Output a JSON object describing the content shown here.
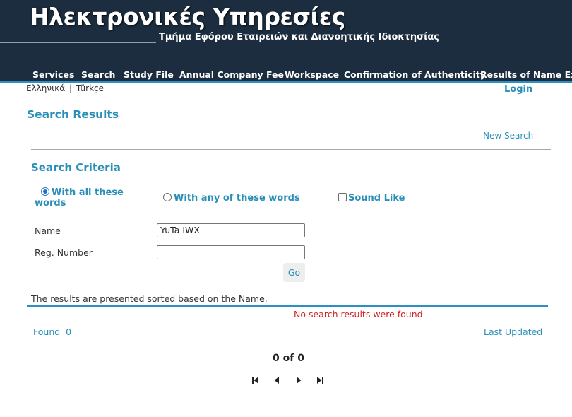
{
  "header": {
    "title": "Ηλεκτρονικές Υπηρεσίες",
    "subtitle": "Τμήμα Εφόρου Εταιρειών και Διανοητικής Ιδιοκτησίας",
    "nav": [
      {
        "label": "Services"
      },
      {
        "label": "Search"
      },
      {
        "label": "Study File"
      },
      {
        "label": "Annual Company Fee"
      },
      {
        "label": "Workspace"
      },
      {
        "label": "Confirmation of Authenticity"
      },
      {
        "label": "Results of Name Exam"
      }
    ]
  },
  "lang": {
    "greek": "Ελληνικά",
    "separator": "|",
    "turkish": "Türkçe"
  },
  "login_label": "Login",
  "page_title": "Search Results",
  "new_search_label": "New Search",
  "criteria": {
    "title": "Search Criteria",
    "options": {
      "all_words_line1": "With all these",
      "all_words_line2": "words",
      "any_words": "With any of these words",
      "sound_like": "Sound Like"
    },
    "selected_option": "all_words",
    "sound_like_checked": false,
    "name_label": "Name",
    "name_value": "YuTa IWX",
    "reg_label": "Reg. Number",
    "reg_value": "",
    "go_label": "Go"
  },
  "results": {
    "sorted_note": "The results are presented sorted based on the Name.",
    "no_results": "No search results were found",
    "found_label": "Found",
    "found_count": "0",
    "last_updated_label": "Last Updated",
    "page_info": "0 of 0"
  },
  "pager_icons": [
    "first-page-icon",
    "previous-page-icon",
    "next-page-icon",
    "last-page-icon"
  ],
  "colors": {
    "header_bg": "#1b2d3e",
    "accent_blue": "#2e8fc4",
    "link_blue": "#2a8fb8",
    "error_red": "#cc2222"
  }
}
